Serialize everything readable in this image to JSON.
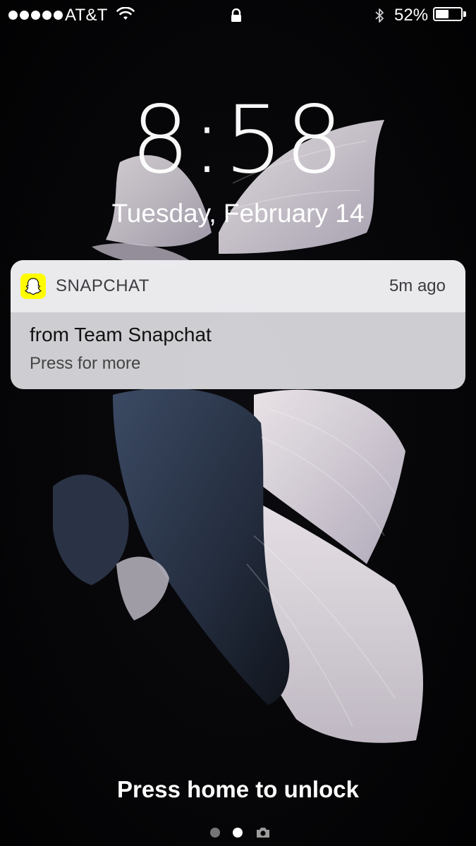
{
  "status_bar": {
    "carrier": "AT&T",
    "signal_bars": 5,
    "battery_percent_text": "52%",
    "battery_level": 0.52,
    "icons": [
      "signal-dots-icon",
      "wifi-icon",
      "lock-icon",
      "bluetooth-icon",
      "battery-icon"
    ]
  },
  "lock_screen": {
    "time": "8:58",
    "date": "Tuesday, February 14",
    "unlock_hint": "Press home to unlock",
    "page_indicators": [
      "page-dot",
      "page-dot-active",
      "camera-icon"
    ]
  },
  "notification": {
    "app_name": "SNAPCHAT",
    "time_ago": "5m ago",
    "title": "from Team Snapchat",
    "subtitle": "Press for more",
    "app_icon": "snapchat-ghost-icon",
    "accent_color": "#FFFC00"
  },
  "colors": {
    "background": "#050507",
    "notification_bg": "#DEDEE2",
    "text_primary": "#FFFFFF"
  }
}
